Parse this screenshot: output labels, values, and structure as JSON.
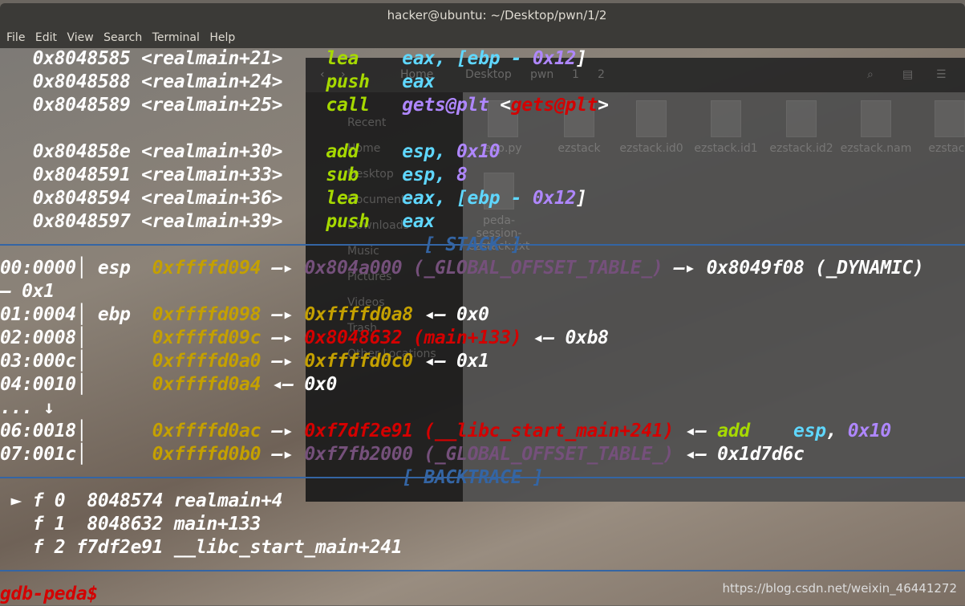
{
  "window": {
    "title": "hacker@ubuntu: ~/Desktop/pwn/1/2",
    "menu": [
      "File",
      "Edit",
      "View",
      "Search",
      "Terminal",
      "Help"
    ]
  },
  "file_manager": {
    "breadcrumbs": [
      "Home",
      "Desktop",
      "pwn",
      "1",
      "2"
    ],
    "sidebar": [
      "Recent",
      "Home",
      "Desktop",
      "Documents",
      "Downloads",
      "Music",
      "Pictures",
      "Videos",
      "Trash",
      "Other Locations"
    ],
    "files": [
      "exp.py",
      "ezstack",
      "ezstack.id0",
      "ezstack.id1",
      "ezstack.id2",
      "ezstack.nam",
      "ezstack",
      "peda-session-ezstack.txt"
    ]
  },
  "colors": {
    "section_rule": "#3465a4",
    "prompt": "#d40000",
    "address": "#c4a000",
    "mnemonic": "#a6d900",
    "register": "#5fd7ff",
    "number": "#af87ff"
  },
  "terminal": {
    "lines": [
      [
        [
          "   0x8048585 <realmain+21>    ",
          "w"
        ],
        [
          "lea    ",
          "g"
        ],
        [
          "eax, [ebp - ",
          "c"
        ],
        [
          "0x12",
          "p"
        ],
        [
          "]",
          "w"
        ]
      ],
      [
        [
          "   0x8048588 <realmain+24>    ",
          "w"
        ],
        [
          "push   ",
          "g"
        ],
        [
          "eax",
          "c"
        ]
      ],
      [
        [
          "   0x8048589 <realmain+25>    ",
          "w"
        ],
        [
          "call   ",
          "g"
        ],
        [
          "gets@plt",
          "p"
        ],
        [
          " <",
          "w"
        ],
        [
          "gets@plt",
          "r"
        ],
        [
          ">",
          "w"
        ]
      ],
      [
        [
          "",
          ""
        ]
      ],
      [
        [
          "   0x804858e <realmain+30>    ",
          "w"
        ],
        [
          "add    ",
          "g"
        ],
        [
          "esp, ",
          "c"
        ],
        [
          "0x10",
          "p"
        ]
      ],
      [
        [
          "   0x8048591 <realmain+33>    ",
          "w"
        ],
        [
          "sub    ",
          "g"
        ],
        [
          "esp, ",
          "c"
        ],
        [
          "8",
          "p"
        ]
      ],
      [
        [
          "   0x8048594 <realmain+36>    ",
          "w"
        ],
        [
          "lea    ",
          "g"
        ],
        [
          "eax, [ebp - ",
          "c"
        ],
        [
          "0x12",
          "p"
        ],
        [
          "]",
          "w"
        ]
      ],
      [
        [
          "   0x8048597 <realmain+39>    ",
          "w"
        ],
        [
          "push   ",
          "g"
        ],
        [
          "eax",
          "c"
        ]
      ],
      [
        [
          "                                       [ STACK ]",
          "b"
        ]
      ],
      [
        [
          "00:0000│ esp  ",
          "w"
        ],
        [
          "0xffffd094",
          "y"
        ],
        [
          " —▸ ",
          "w"
        ],
        [
          "0x804a000 (_GLOBAL_OFFSET_TABLE_)",
          "m"
        ],
        [
          " —▸ 0x8049f08 (_DYNAMIC)",
          "w"
        ]
      ],
      [
        [
          "— 0x1",
          "w"
        ]
      ],
      [
        [
          "01:0004│ ebp  ",
          "w"
        ],
        [
          "0xffffd098",
          "y"
        ],
        [
          " —▸ ",
          "w"
        ],
        [
          "0xffffd0a8",
          "y"
        ],
        [
          " ◂— 0x0",
          "w"
        ]
      ],
      [
        [
          "02:0008│      ",
          "w"
        ],
        [
          "0xffffd09c",
          "y"
        ],
        [
          " —▸ ",
          "w"
        ],
        [
          "0x8048632 (main+133)",
          "r"
        ],
        [
          " ◂— 0xb8",
          "w"
        ]
      ],
      [
        [
          "03:000c│      ",
          "w"
        ],
        [
          "0xffffd0a0",
          "y"
        ],
        [
          " —▸ ",
          "w"
        ],
        [
          "0xffffd0c0",
          "y"
        ],
        [
          " ◂— 0x1",
          "w"
        ]
      ],
      [
        [
          "04:0010│      ",
          "w"
        ],
        [
          "0xffffd0a4",
          "y"
        ],
        [
          " ◂— 0x0",
          "w"
        ]
      ],
      [
        [
          "... ↓",
          "w"
        ]
      ],
      [
        [
          "06:0018│      ",
          "w"
        ],
        [
          "0xffffd0ac",
          "y"
        ],
        [
          " —▸ ",
          "w"
        ],
        [
          "0xf7df2e91 (__libc_start_main+241)",
          "r"
        ],
        [
          " ◂— ",
          "w"
        ],
        [
          "add    ",
          "g"
        ],
        [
          "esp",
          "c"
        ],
        [
          ", ",
          "w"
        ],
        [
          "0x10",
          "p"
        ]
      ],
      [
        [
          "07:001c│      ",
          "w"
        ],
        [
          "0xffffd0b0",
          "y"
        ],
        [
          " —▸ ",
          "w"
        ],
        [
          "0xf7fb2000 (_GLOBAL_OFFSET_TABLE_)",
          "m"
        ],
        [
          " ◂— 0x1d7d6c",
          "w"
        ]
      ],
      [
        [
          "                                     [ BACKTRACE ]",
          "b"
        ]
      ],
      [
        [
          " ► f 0  8048574 realmain+4",
          "w"
        ]
      ],
      [
        [
          "   f 1  8048632 main+133",
          "w"
        ]
      ],
      [
        [
          "   f 2 f7df2e91 __libc_start_main+241",
          "w"
        ]
      ],
      [
        [
          "",
          ""
        ]
      ],
      [
        [
          "gdb-peda$",
          "d"
        ]
      ]
    ]
  },
  "watermark": "https://blog.csdn.net/weixin_46441272"
}
